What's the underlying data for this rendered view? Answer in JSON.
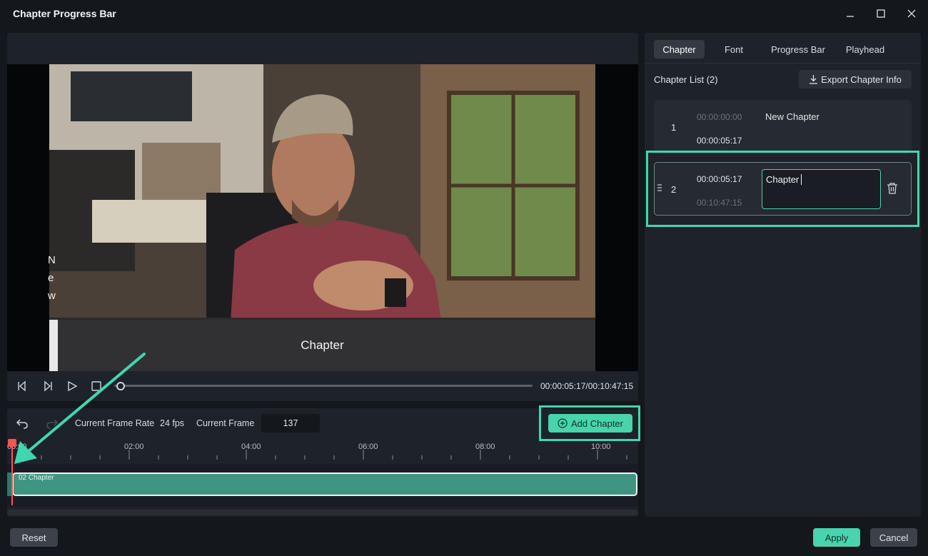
{
  "window": {
    "title": "Chapter Progress Bar"
  },
  "preview": {
    "subtitle": "Chapter",
    "side_text": [
      "N",
      "e",
      "w"
    ],
    "timecode": "00:00:05:17/00:10:47:15",
    "progress": 0.009
  },
  "timeline": {
    "frame_rate_label": "Current Frame Rate",
    "frame_rate_value": "24 fps",
    "current_frame_label": "Current Frame",
    "current_frame_value": "137",
    "add_chapter_label": "Add Chapter",
    "ruler": [
      "00:00",
      "02:00",
      "04:00",
      "06:00",
      "08:00",
      "10:00"
    ],
    "clip_label": "02 Chapter"
  },
  "tabs": [
    "Chapter",
    "Font",
    "Progress Bar",
    "Playhead"
  ],
  "chapter_list": {
    "title": "Chapter List (2)",
    "export_label": "Export Chapter Info",
    "items": [
      {
        "num": "1",
        "start": "00:00:00:00",
        "end": "00:00:05:17",
        "name": "New Chapter"
      },
      {
        "num": "2",
        "start": "00:00:05:17",
        "end": "00:10:47:15",
        "name": "Chapter"
      }
    ]
  },
  "footer": {
    "reset": "Reset",
    "apply": "Apply",
    "cancel": "Cancel"
  },
  "colors": {
    "accent": "#48d4ad",
    "annotation": "#3fd7b0",
    "playhead": "#ff5252"
  }
}
